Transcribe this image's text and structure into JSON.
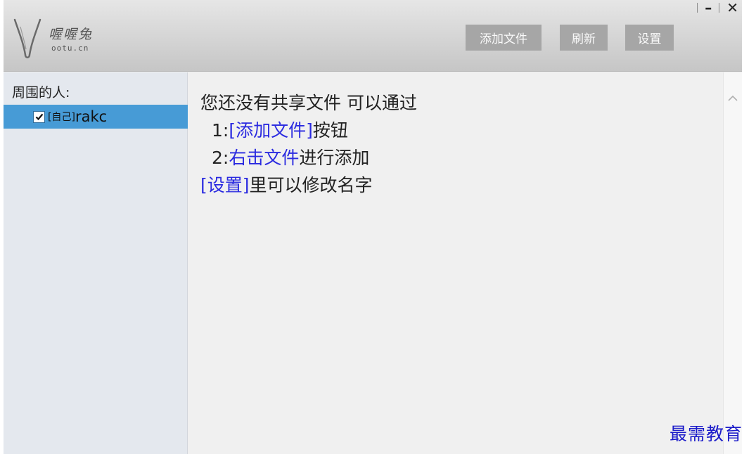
{
  "app": {
    "logo_name": "喔喔兔",
    "logo_url": "ootu.cn"
  },
  "window_controls": {
    "minimize_icon": "minimize-icon",
    "close_icon": "close-icon"
  },
  "toolbar": {
    "add_file_label": "添加文件",
    "refresh_label": "刷新",
    "settings_label": "设置"
  },
  "sidebar": {
    "title": "周围的人:",
    "users": [
      {
        "tag": "[自己]",
        "name": "rakc",
        "checked": true
      }
    ]
  },
  "content": {
    "line1": "您还没有共享文件 可以通过",
    "line2_prefix": "1:",
    "line2_link": "[添加文件]",
    "line2_suffix": "按钮",
    "line3_prefix": "2:",
    "line3_link": "右击文件",
    "line3_suffix": "进行添加",
    "line4_link": "[设置]",
    "line4_suffix": "里可以修改名字"
  },
  "colors": {
    "link": "#2a2ae0",
    "selection": "#479bd6",
    "toolbar_button": "#a6a6a6"
  },
  "watermark": "最需教育"
}
